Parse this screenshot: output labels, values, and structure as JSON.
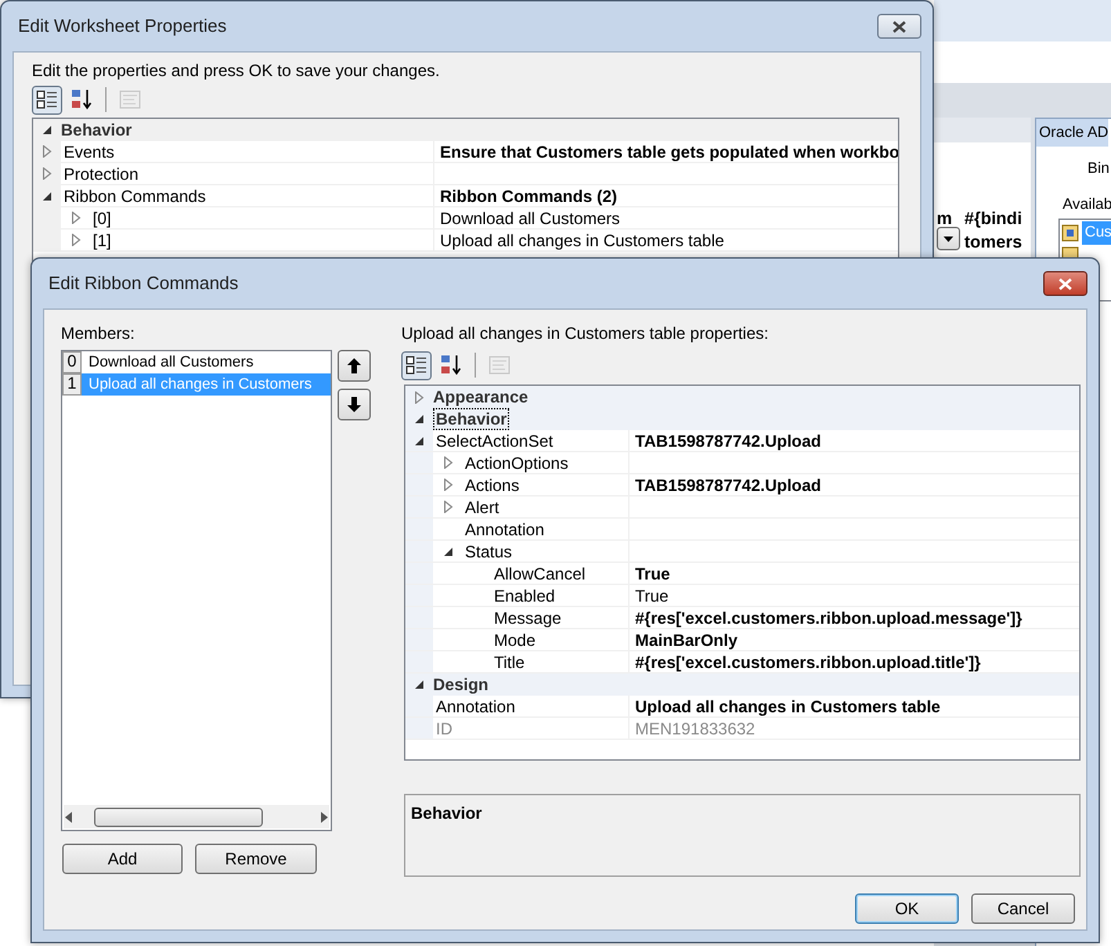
{
  "background": {
    "cells": [
      {
        "text": "m"
      },
      {
        "text": "#{bindi"
      },
      {
        "text": "tomers"
      }
    ],
    "panel": {
      "title": "Oracle AD",
      "label_1": "Bin",
      "label_2": "Availab",
      "items": [
        {
          "label": "Cus",
          "selected": true
        }
      ]
    }
  },
  "back_window": {
    "title": "Edit Worksheet Properties",
    "instruction": "Edit the properties and press OK to save your changes.",
    "toolbar": [
      {
        "kind": "categorized",
        "pressed": true,
        "disabled": false
      },
      {
        "kind": "alphabetical",
        "pressed": false,
        "disabled": false
      },
      {
        "kind": "pages",
        "pressed": false,
        "disabled": true
      }
    ],
    "grid": [
      {
        "kind": "category",
        "name": "Behavior",
        "expanded": true,
        "focused": false,
        "children": [
          {
            "kind": "property",
            "name": "Events",
            "expanded": false,
            "value": "Ensure that Customers table gets populated when workbo",
            "modified": true
          },
          {
            "kind": "property",
            "name": "Protection",
            "expanded": false
          },
          {
            "kind": "property",
            "name": "Ribbon Commands",
            "expanded": true,
            "value": "Ribbon Commands (2)",
            "modified": true,
            "children": [
              {
                "kind": "property",
                "name": "[0]",
                "expanded": false,
                "value": "Download all Customers",
                "modified": false
              },
              {
                "kind": "property",
                "name": "[1]",
                "expanded": false,
                "value": "Upload all changes in Customers table",
                "modified": false
              }
            ]
          }
        ]
      }
    ]
  },
  "dialog": {
    "title": "Edit Ribbon Commands",
    "members_label": "Members:",
    "members": [
      {
        "index": "0",
        "label": "Download all Customers",
        "selected": false
      },
      {
        "index": "1",
        "label": "Upload all changes in Customers",
        "selected": true
      }
    ],
    "add_button": "Add",
    "remove_button": "Remove",
    "properties_label": "Upload all changes in Customers table properties:",
    "toolbar": [
      {
        "kind": "categorized",
        "pressed": true,
        "disabled": false
      },
      {
        "kind": "alphabetical",
        "pressed": false,
        "disabled": false
      },
      {
        "kind": "pages",
        "pressed": false,
        "disabled": true
      }
    ],
    "grid": [
      {
        "kind": "category",
        "name": "Appearance",
        "expanded": false,
        "focused": false
      },
      {
        "kind": "category",
        "name": "Behavior",
        "expanded": true,
        "focused": true,
        "children": [
          {
            "kind": "property",
            "name": "SelectActionSet",
            "expanded": true,
            "value": "TAB1598787742.Upload",
            "modified": true,
            "children": [
              {
                "kind": "property",
                "name": "ActionOptions",
                "expanded": false
              },
              {
                "kind": "property",
                "name": "Actions",
                "expanded": false,
                "value": "TAB1598787742.Upload",
                "modified": true
              },
              {
                "kind": "property",
                "name": "Alert",
                "expanded": false
              },
              {
                "kind": "property",
                "name": "Annotation"
              },
              {
                "kind": "property",
                "name": "Status",
                "expanded": true,
                "children": [
                  {
                    "kind": "property",
                    "name": "AllowCancel",
                    "value": "True",
                    "modified": true
                  },
                  {
                    "kind": "property",
                    "name": "Enabled",
                    "value": "True",
                    "modified": false
                  },
                  {
                    "kind": "property",
                    "name": "Message",
                    "value": "#{res['excel.customers.ribbon.upload.message']}",
                    "modified": true
                  },
                  {
                    "kind": "property",
                    "name": "Mode",
                    "value": "MainBarOnly",
                    "modified": true
                  },
                  {
                    "kind": "property",
                    "name": "Title",
                    "value": "#{res['excel.customers.ribbon.upload.title']}",
                    "modified": true
                  }
                ]
              }
            ]
          }
        ]
      },
      {
        "kind": "category",
        "name": "Design",
        "expanded": true,
        "focused": false,
        "children": [
          {
            "kind": "property",
            "name": "Annotation",
            "value": "Upload all changes in Customers table",
            "modified": true
          },
          {
            "kind": "property",
            "name": "ID",
            "value": "MEN191833632",
            "modified": false,
            "readonly": true
          }
        ]
      }
    ],
    "description": "Behavior",
    "ok_button": "OK",
    "cancel_button": "Cancel"
  }
}
